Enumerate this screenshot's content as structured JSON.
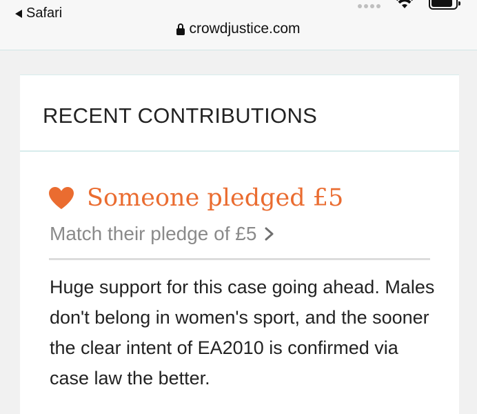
{
  "status_bar": {
    "back_app_label": "Safari"
  },
  "browser": {
    "url": "crowdjustice.com"
  },
  "contributions": {
    "section_title": "RECENT CONTRIBUTIONS",
    "items": [
      {
        "pledge_text": "Someone pledged £5",
        "match_link_text": "Match their pledge of £5",
        "comment": "Huge support for this case going ahead. Males don't belong in women's sport, and the sooner the clear intent of EA2010 is confirmed via case law the better."
      }
    ]
  },
  "colors": {
    "accent": "#ea6c30",
    "muted_text": "#8a8a8a",
    "divider": "#dcdcdc",
    "card_border": "#d7ecec"
  },
  "icons": {
    "back": "back-triangle-icon",
    "lock": "lock-icon",
    "heart": "heart-icon",
    "chevron": "chevron-right-icon",
    "wifi": "wifi-icon",
    "battery": "battery-icon"
  }
}
